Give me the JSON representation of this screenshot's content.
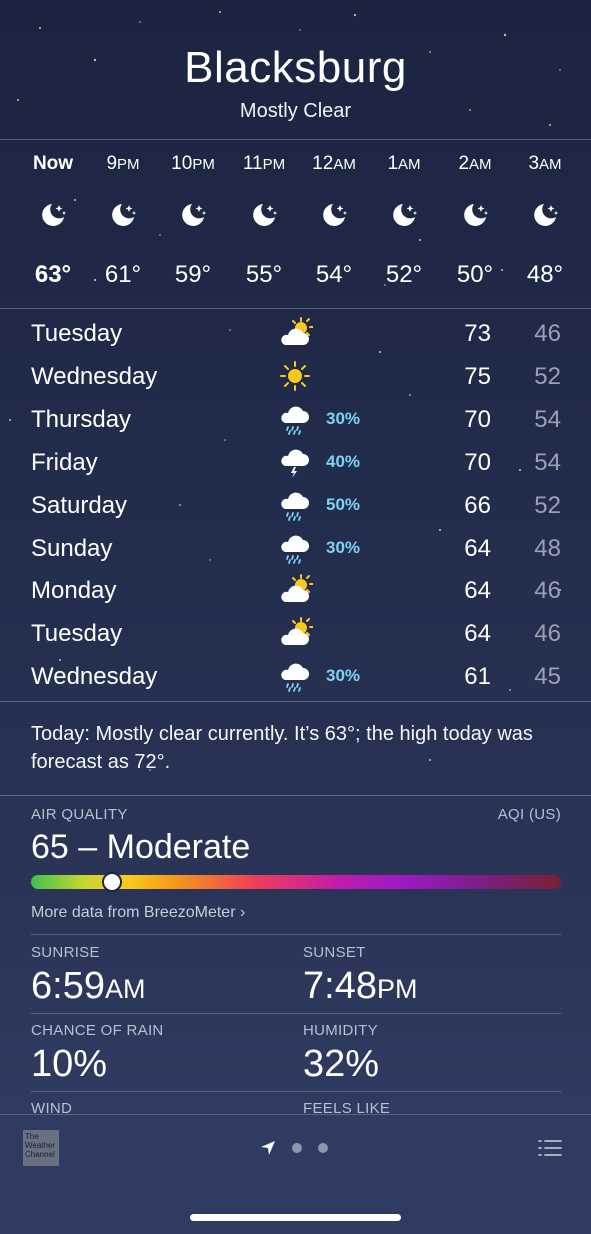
{
  "location": {
    "city": "Blacksburg",
    "condition": "Mostly Clear"
  },
  "hourly": [
    {
      "hour": "Now",
      "suffix": "",
      "temp": "63°",
      "icon": "moon-stars-icon"
    },
    {
      "hour": "9",
      "suffix": "PM",
      "temp": "61°",
      "icon": "moon-stars-icon"
    },
    {
      "hour": "10",
      "suffix": "PM",
      "temp": "59°",
      "icon": "moon-stars-icon"
    },
    {
      "hour": "11",
      "suffix": "PM",
      "temp": "55°",
      "icon": "moon-stars-icon"
    },
    {
      "hour": "12",
      "suffix": "AM",
      "temp": "54°",
      "icon": "moon-stars-icon"
    },
    {
      "hour": "1",
      "suffix": "AM",
      "temp": "52°",
      "icon": "moon-stars-icon"
    },
    {
      "hour": "2",
      "suffix": "AM",
      "temp": "50°",
      "icon": "moon-stars-icon"
    },
    {
      "hour": "3",
      "suffix": "AM",
      "temp": "48°",
      "icon": "moon-stars-icon"
    }
  ],
  "daily": [
    {
      "day": "Tuesday",
      "icon": "partly-sunny-icon",
      "precip": "",
      "high": "73",
      "low": "46"
    },
    {
      "day": "Wednesday",
      "icon": "sun-icon",
      "precip": "",
      "high": "75",
      "low": "52"
    },
    {
      "day": "Thursday",
      "icon": "rain-cloud-icon",
      "precip": "30%",
      "high": "70",
      "low": "54"
    },
    {
      "day": "Friday",
      "icon": "thunderstorm-icon",
      "precip": "40%",
      "high": "70",
      "low": "54"
    },
    {
      "day": "Saturday",
      "icon": "rain-cloud-icon",
      "precip": "50%",
      "high": "66",
      "low": "52"
    },
    {
      "day": "Sunday",
      "icon": "rain-cloud-icon",
      "precip": "30%",
      "high": "64",
      "low": "48"
    },
    {
      "day": "Monday",
      "icon": "partly-sunny-icon",
      "precip": "",
      "high": "64",
      "low": "46"
    },
    {
      "day": "Tuesday",
      "icon": "partly-sunny-icon",
      "precip": "",
      "high": "64",
      "low": "46"
    },
    {
      "day": "Wednesday",
      "icon": "rain-cloud-icon",
      "precip": "30%",
      "high": "61",
      "low": "45"
    }
  ],
  "summary": "Today: Mostly clear currently. It’s 63°; the high today was forecast as 72°.",
  "air_quality": {
    "label": "AIR QUALITY",
    "scale": "AQI (US)",
    "value": "65 – Moderate",
    "aqi": 65,
    "more_link": "More data from BreezoMeter"
  },
  "details": {
    "sunrise": {
      "label": "SUNRISE",
      "time": "6:59",
      "suffix": "AM"
    },
    "sunset": {
      "label": "SUNSET",
      "time": "7:48",
      "suffix": "PM"
    },
    "chance_of_rain": {
      "label": "CHANCE OF RAIN",
      "value": "10%"
    },
    "humidity": {
      "label": "HUMIDITY",
      "value": "32%"
    },
    "wind": {
      "label": "WIND"
    },
    "feels_like": {
      "label": "FEELS LIKE"
    }
  },
  "footer": {
    "logo_text": "The Weather Channel"
  },
  "colors": {
    "precip": "#7ed2f5",
    "sun": "#f8c81e",
    "background": "#1f2947"
  }
}
